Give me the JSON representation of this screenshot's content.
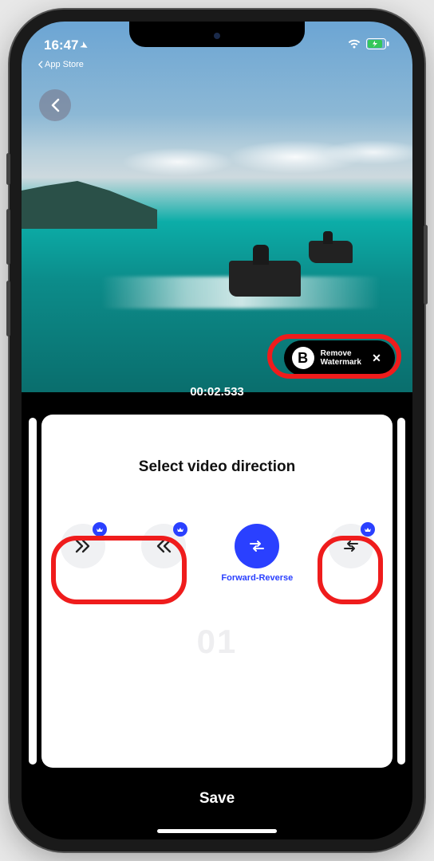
{
  "status": {
    "time": "16:47",
    "breadcrumb": "App Store"
  },
  "video": {
    "timecode": "00:02.533"
  },
  "watermark": {
    "badge": "B",
    "line1": "Remove",
    "line2": "Watermark"
  },
  "panel": {
    "title": "Select video direction",
    "counter": "01"
  },
  "directions": {
    "forward": {
      "label": ""
    },
    "reverse": {
      "label": ""
    },
    "forward_reverse": {
      "label": "Forward-Reverse"
    },
    "reverse_forward": {
      "label": ""
    }
  },
  "actions": {
    "save": "Save"
  }
}
